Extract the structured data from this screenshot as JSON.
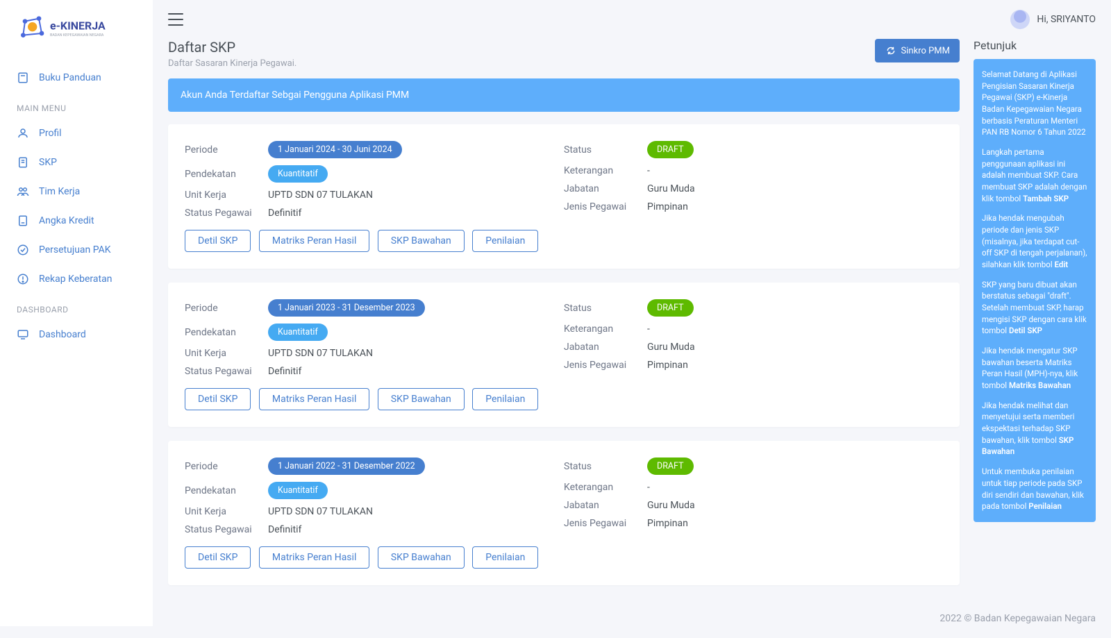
{
  "user": {
    "greeting": "Hi, SRIYANTO"
  },
  "sidebar": {
    "buku_panduan": "Buku Panduan",
    "section_main": "MAIN MENU",
    "items": [
      "Profil",
      "SKP",
      "Tim Kerja",
      "Angka Kredit",
      "Persetujuan PAK",
      "Rekap Keberatan"
    ],
    "section_dashboard": "DASHBOARD",
    "dashboard": "Dashboard"
  },
  "page": {
    "title": "Daftar SKP",
    "subtitle": "Daftar Sasaran Kinerja Pegawai.",
    "sinkro": "Sinkro PMM",
    "alert": "Akun Anda Terdaftar Sebgai Pengguna Aplikasi PMM"
  },
  "labels": {
    "periode": "Periode",
    "pendekatan": "Pendekatan",
    "unit_kerja": "Unit Kerja",
    "status_pegawai": "Status Pegawai",
    "status": "Status",
    "keterangan": "Keterangan",
    "jabatan": "Jabatan",
    "jenis_pegawai": "Jenis Pegawai"
  },
  "buttons": {
    "detil": "Detil SKP",
    "matriks": "Matriks Peran Hasil",
    "skp_bawahan": "SKP Bawahan",
    "penilaian": "Penilaian"
  },
  "skp": [
    {
      "periode": "1 Januari 2024 - 30 Juni 2024",
      "pendekatan": "Kuantitatif",
      "unit_kerja": "UPTD SDN 07 TULAKAN",
      "status_pegawai": "Definitif",
      "status": "DRAFT",
      "keterangan": "-",
      "jabatan": "Guru Muda",
      "jenis_pegawai": "Pimpinan"
    },
    {
      "periode": "1 Januari 2023 - 31 Desember 2023",
      "pendekatan": "Kuantitatif",
      "unit_kerja": "UPTD SDN 07 TULAKAN",
      "status_pegawai": "Definitif",
      "status": "DRAFT",
      "keterangan": "-",
      "jabatan": "Guru Muda",
      "jenis_pegawai": "Pimpinan"
    },
    {
      "periode": "1 Januari 2022 - 31 Desember 2022",
      "pendekatan": "Kuantitatif",
      "unit_kerja": "UPTD SDN 07 TULAKAN",
      "status_pegawai": "Definitif",
      "status": "DRAFT",
      "keterangan": "-",
      "jabatan": "Guru Muda",
      "jenis_pegawai": "Pimpinan"
    }
  ],
  "petunjuk": {
    "title": "Petunjuk",
    "p1a": "Selamat Datang di Aplikasi Pengisian Sasaran Kinerja Pegawai (SKP) e-Kinerja Badan Kepegawaian Negara berbasis Peraturan Menteri PAN RB Nomor 6 Tahun 2022",
    "p2a": "Langkah pertama penggunaan aplikasi ini adalah membuat SKP. Cara membuat SKP adalah dengan klik tombol ",
    "p2b": "Tambah SKP",
    "p3a": "Jika hendak mengubah periode dan jenis SKP (misalnya, jika terdapat cut-off SKP di tengah perjalanan), silahkan klik tombol ",
    "p3b": "Edit",
    "p4a": "SKP yang baru dibuat akan berstatus sebagai \"draft\". Setelah membuat SKP, harap mengisi SKP dengan cara klik tombol ",
    "p4b": "Detil SKP",
    "p5a": "Jika hendak mengatur SKP bawahan beserta Matriks Peran Hasil (MPH)-nya, klik tombol ",
    "p5b": "Matriks Bawahan",
    "p6a": "Jika hendak melihat dan menyetujui serta memberi ekspektasi terhadap SKP bawahan, klik tombol ",
    "p6b": "SKP Bawahan",
    "p7a": "Untuk membuka penilaian untuk tiap periode pada SKP diri sendiri dan bawahan, klik pada tombol ",
    "p7b": "Penilaian"
  },
  "footer": "2022 © Badan Kepegawaian Negara"
}
